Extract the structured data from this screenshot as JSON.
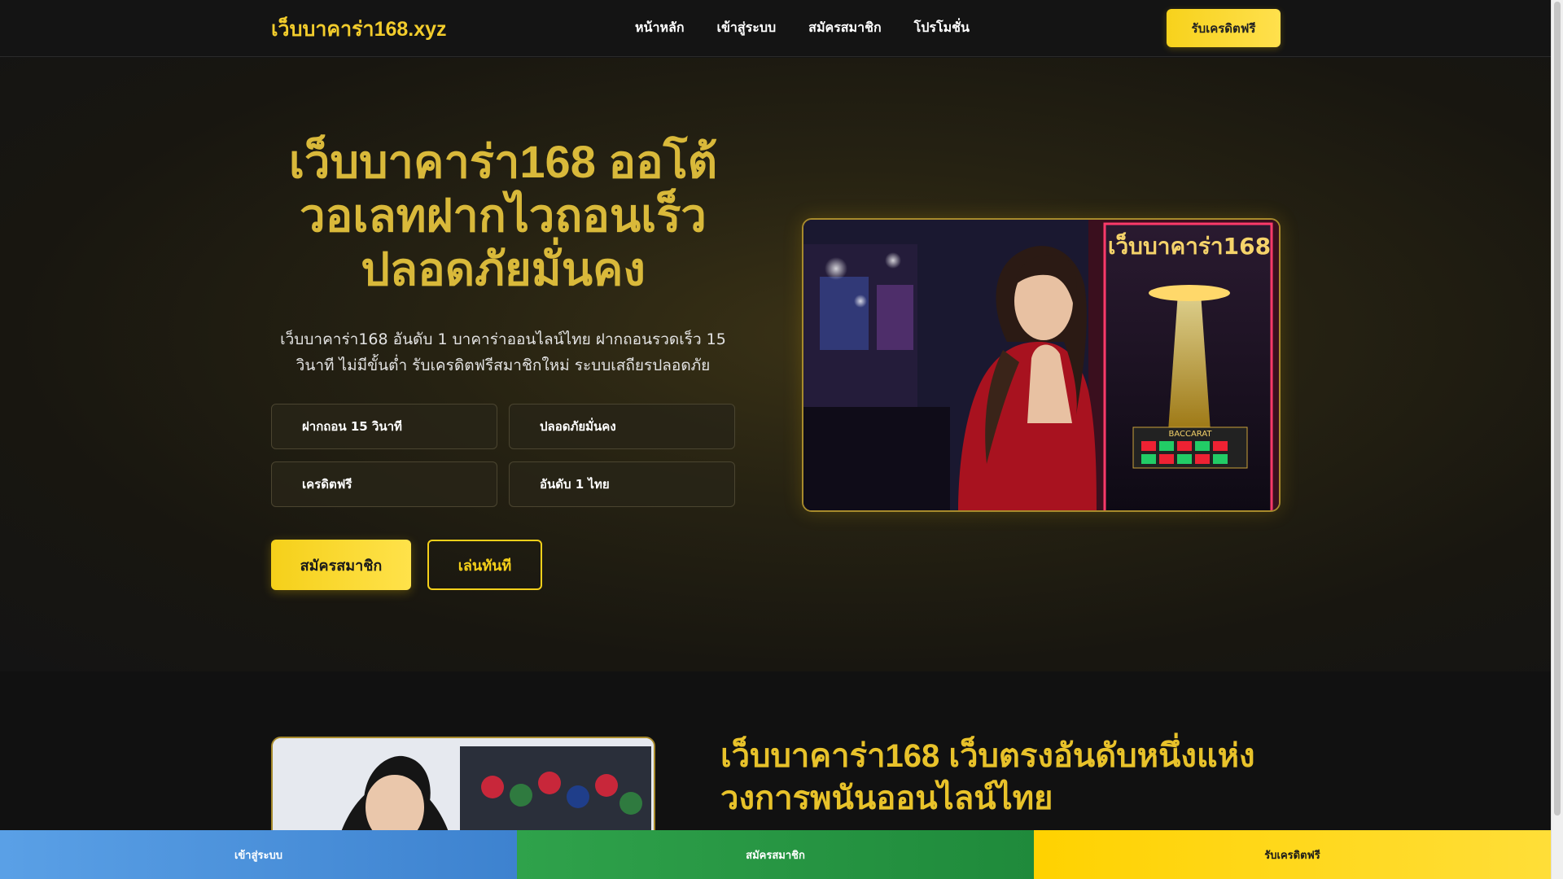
{
  "header": {
    "logo": "เว็บบาคาร่า168.xyz",
    "nav": [
      "หน้าหลัก",
      "เข้าสู่ระบบ",
      "สมัครสมาชิก",
      "โปรโมชั่น"
    ],
    "cta": "รับเครดิตฟรี"
  },
  "hero": {
    "title_lines": [
      "เว็บบาคาร่า168 ออโต้",
      "วอเลทฝากไวถอนเร็ว",
      "ปลอดภัยมั่นคง"
    ],
    "description_lines": [
      "เว็บบาคาร่า168 อันดับ 1 บาคาร่าออนไลน์ไทย ฝากถอนรวดเร็ว 15",
      "วินาที ไม่มีขั้นต่ำ รับเครดิตฟรีสมาชิกใหม่ ระบบเสถียรปลอดภัย"
    ],
    "features": [
      "ฝากถอน 15 วินาที",
      "ปลอดภัยมั่นคง",
      "เครดิตฟรี",
      "อันดับ 1 ไทย"
    ],
    "primary_button": "สมัครสมาชิก",
    "secondary_button": "เล่นทันที",
    "image_sign": "เว็บบาคาร่า168",
    "image_machine_label": "BACCARAT"
  },
  "section2": {
    "title_lines": [
      "เว็บบาคาร่า168 เว็บตรงอันดับหนึ่งแห่ง",
      "วงการพนันออนไลน์ไทย"
    ]
  },
  "bottom_bar": {
    "login": "เข้าสู่ระบบ",
    "register": "สมัครสมาชิก",
    "credit": "รับเครดิตฟรี"
  }
}
